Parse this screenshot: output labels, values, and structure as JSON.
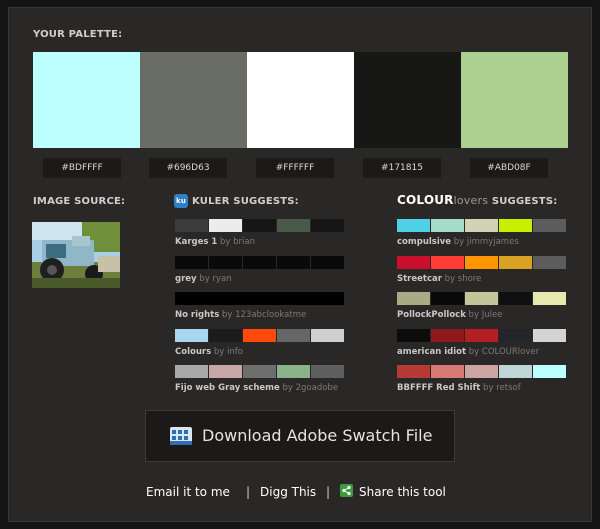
{
  "palette": {
    "heading": "YOUR PALETTE:",
    "colors": [
      "#BDFFFF",
      "#696D63",
      "#FFFFFF",
      "#171815",
      "#ABD08F"
    ],
    "labels": [
      "#BDFFFF",
      "#696D63",
      "#FFFFFF",
      "#171815",
      "#ABD08F"
    ]
  },
  "image_source": {
    "heading": "IMAGE SOURCE:"
  },
  "kuler": {
    "brand": "KULER",
    "heading_suffix": " SUGGESTS:",
    "icon_text": "ku",
    "items": [
      {
        "name": "Karges 1",
        "by": " by ",
        "author": "brian",
        "colors": [
          "#3c3c3c",
          "#ececec",
          "#161616",
          "#4a5a4a",
          "#161616"
        ]
      },
      {
        "name": "grey",
        "by": " by ",
        "author": "ryan",
        "colors": [
          "#0a0a0a",
          "#0a0a0a",
          "#0a0a0a",
          "#0a0a0a",
          "#0a0a0a"
        ]
      },
      {
        "name": "No rights",
        "by": " by ",
        "author": "123abclookatme",
        "colors": [
          "#000000"
        ]
      },
      {
        "name": "Colours",
        "by": " by ",
        "author": "info",
        "colors": [
          "#a7d6f0",
          "#1c1c1c",
          "#ff4a0e",
          "#666666",
          "#cfcfcf"
        ]
      },
      {
        "name": "Fijo web Gray scheme",
        "by": " by ",
        "author": "2goadobe",
        "colors": [
          "#a9a9a9",
          "#c9a6a6",
          "#6e6e6e",
          "#8ab38b",
          "#5e5e5e"
        ]
      }
    ]
  },
  "colourlovers": {
    "brand_main": "COLOUR",
    "brand_sub": "lovers",
    "heading_suffix": " SUGGESTS:",
    "items": [
      {
        "name": "compulsive",
        "by": " by ",
        "author": "jimmyjames",
        "colors": [
          "#4fd0e6",
          "#a3dcc8",
          "#cfd3b3",
          "#c6f000",
          "#5c5c5c"
        ]
      },
      {
        "name": "Streetcar",
        "by": " by ",
        "author": "shore",
        "colors": [
          "#c8102e",
          "#ff3d35",
          "#ff9500",
          "#d9a225",
          "#5c5c5c"
        ]
      },
      {
        "name": "PollockPollock",
        "by": " by ",
        "author": "Julee",
        "colors": [
          "#a9ab86",
          "#0a0a0a",
          "#c3c69a",
          "#101010",
          "#e6e8b0"
        ]
      },
      {
        "name": "american idiot",
        "by": " by ",
        "author": "COLOURlover",
        "colors": [
          "#0c0c0c",
          "#8e1b1b",
          "#b51f24",
          "#23252b",
          "#d4d4d4"
        ]
      },
      {
        "name": "BBFFFF Red Shift",
        "by": " by ",
        "author": "retsof",
        "colors": [
          "#b53a35",
          "#d77a75",
          "#cda6a3",
          "#bfd6d6",
          "#bbffff"
        ]
      }
    ]
  },
  "download": {
    "label": "Download Adobe Swatch File",
    "icon": "swatch-file-icon"
  },
  "links": {
    "email": "Email it to me",
    "sep1": "|",
    "digg": "Digg This",
    "sep2": "|",
    "share": "Share this tool",
    "share_icon": "share-icon"
  }
}
